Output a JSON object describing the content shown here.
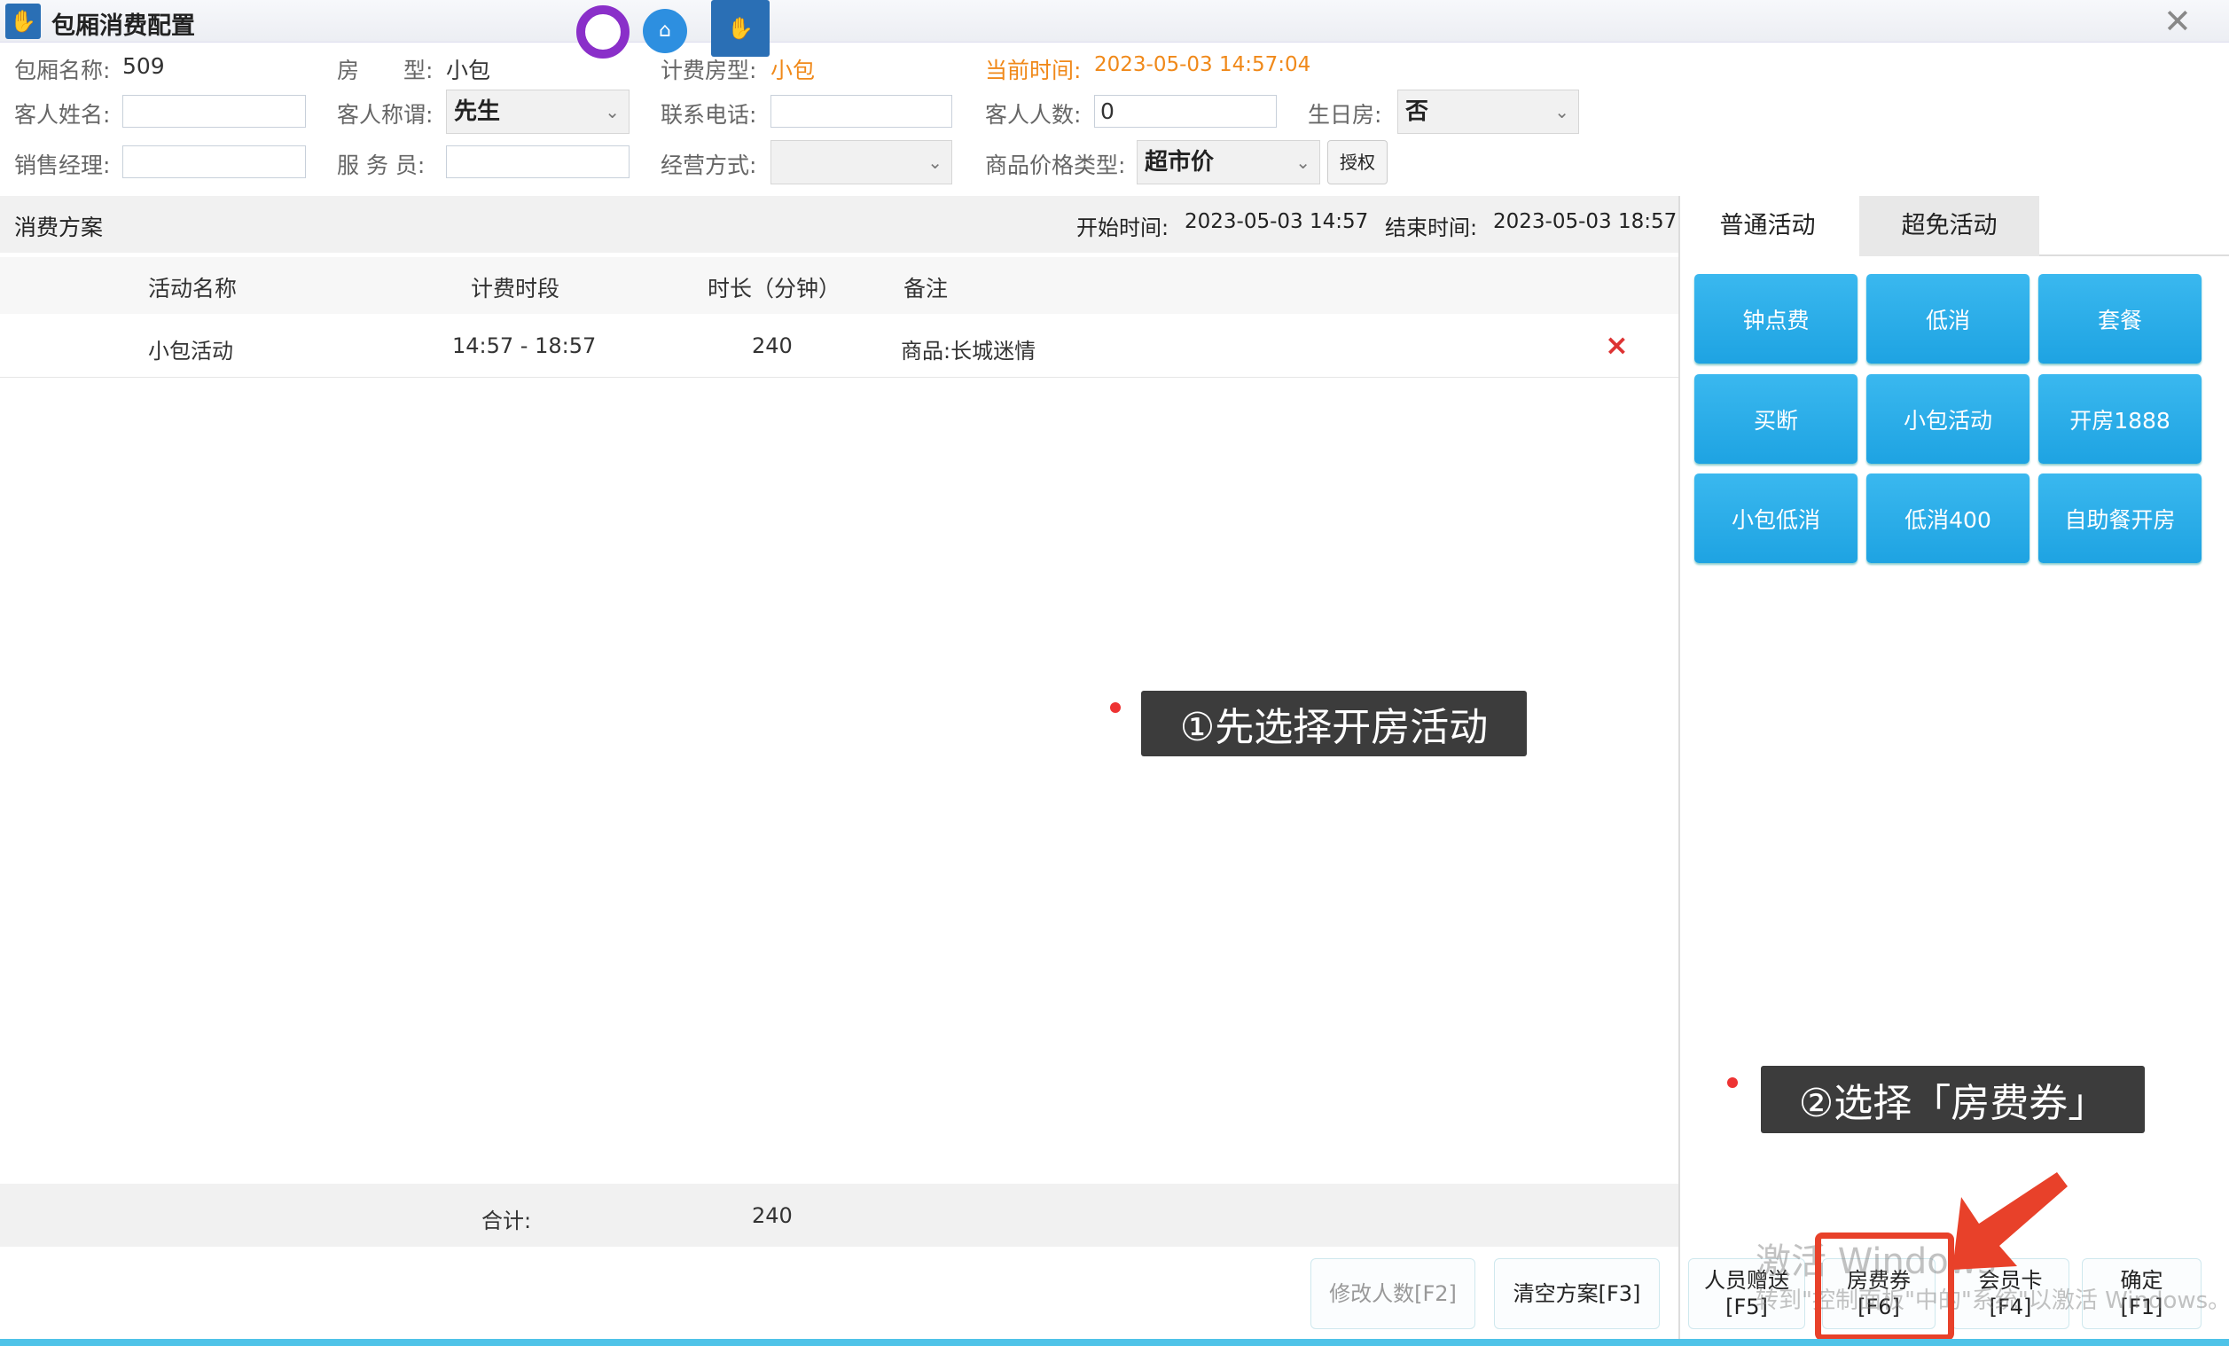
{
  "window": {
    "title": "包厢消费配置",
    "close": "✕"
  },
  "info": {
    "room_name_label": "包厢名称:",
    "room_name": "509",
    "room_type_label": "房　　型:",
    "room_type": "小包",
    "billing_type_label": "计费房型:",
    "billing_type": "小包",
    "current_time_label": "当前时间:",
    "current_time": "2023-05-03 14:57:04",
    "guest_name_label": "客人姓名:",
    "guest_name": "",
    "title_label": "客人称谓:",
    "title_value": "先生",
    "phone_label": "联系电话:",
    "phone": "",
    "guest_count_label": "客人人数:",
    "guest_count": "0",
    "birthday_label": "生日房:",
    "birthday": "否",
    "sales_manager_label": "销售经理:",
    "sales_manager": "",
    "waiter_label": "服 务 员:",
    "waiter": "",
    "mode_label": "经营方式:",
    "mode": "",
    "price_type_label": "商品价格类型:",
    "price_type": "超市价",
    "authorize": "授权"
  },
  "plan": {
    "title": "消费方案",
    "start_label": "开始时间:",
    "start": "2023-05-03 14:57",
    "end_label": "结束时间:",
    "end": "2023-05-03 18:57",
    "columns": [
      "活动名称",
      "计费时段",
      "时长（分钟）",
      "备注"
    ],
    "rows": [
      {
        "name": "小包活动",
        "period": "14:57 - 18:57",
        "duration": "240",
        "note": "商品:长城迷情",
        "delete": "×"
      }
    ],
    "total_label": "合计:",
    "total": "240"
  },
  "tabs": [
    "普通活动",
    "超免活动"
  ],
  "activities": [
    "钟点费",
    "低消",
    "套餐",
    "买断",
    "小包活动",
    "开房1888",
    "小包低消",
    "低消400",
    "自助餐开房"
  ],
  "buttons": {
    "edit_count": "修改人数[F2]",
    "clear": "清空方案[F3]",
    "gift": [
      "人员赠送",
      "[F5]"
    ],
    "voucher": [
      "房费券",
      "[F6]"
    ],
    "member": [
      "会员卡",
      "[F4]"
    ],
    "confirm": [
      "确定",
      "[F1]"
    ]
  },
  "annotations": {
    "step1": "①先选择开房活动",
    "step2": "②选择「房费券」"
  },
  "watermark": {
    "line1": "激活 Windows",
    "line2": "转到\"控制面板\"中的\"系统\"以激活 Windows。"
  },
  "colors": {
    "accent": "#1ea3e2",
    "highlight": "#e8412a",
    "orange": "#f0891a"
  }
}
